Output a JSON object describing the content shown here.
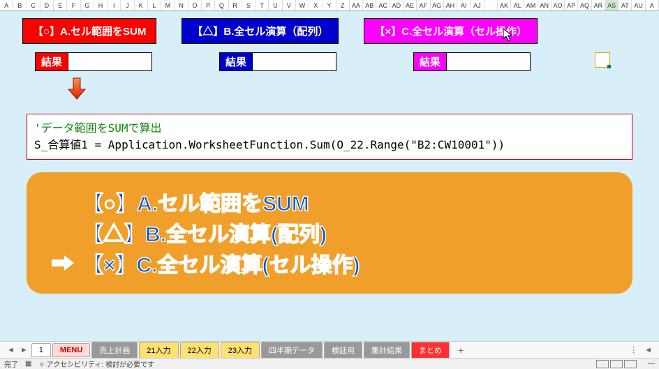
{
  "columns": [
    "A",
    "B",
    "C",
    "D",
    "E",
    "F",
    "G",
    "H",
    "I",
    "J",
    "K",
    "L",
    "M",
    "N",
    "O",
    "P",
    "Q",
    "R",
    "S",
    "T",
    "U",
    "V",
    "W",
    "X",
    "Y",
    "Z",
    "AA",
    "AB",
    "AC",
    "AD",
    "AE",
    "AF",
    "AG",
    "AH",
    "AI",
    "AJ",
    "",
    "AK",
    "AL",
    "AM",
    "AN",
    "AO",
    "AP",
    "AQ",
    "AR",
    "AS",
    "AT",
    "AU",
    "A"
  ],
  "selected_col": "AS",
  "buttons": {
    "a": "【○】A.セル範囲をSUM",
    "b": "【△】B.全セル演算（配列）",
    "c": "【×】C.全セル演算（セル操作）"
  },
  "result_label": "結果",
  "code": {
    "comment": "'データ範囲をSUMで算出",
    "line": "S_合算値1 = Application.WorksheetFunction.Sum(O_22.Range(\"B2:CW10001\"))"
  },
  "summary": {
    "a": "【○】A.セル範囲をSUM",
    "b": "【△】B.全セル演算(配列)",
    "c": "【×】C.全セル演算(セル操作)"
  },
  "tabs": {
    "num": "1",
    "menu": "MENU",
    "t1": "売上計画",
    "t2": "21入力",
    "t3": "22入力",
    "t4": "23入力",
    "t5": "四半期データ",
    "t6": "検証用",
    "t7": "集計結果",
    "t8": "まとめ",
    "plus": "+"
  },
  "status": {
    "ready": "完了",
    "access": "アクセシビリティ: 検討が必要です"
  }
}
